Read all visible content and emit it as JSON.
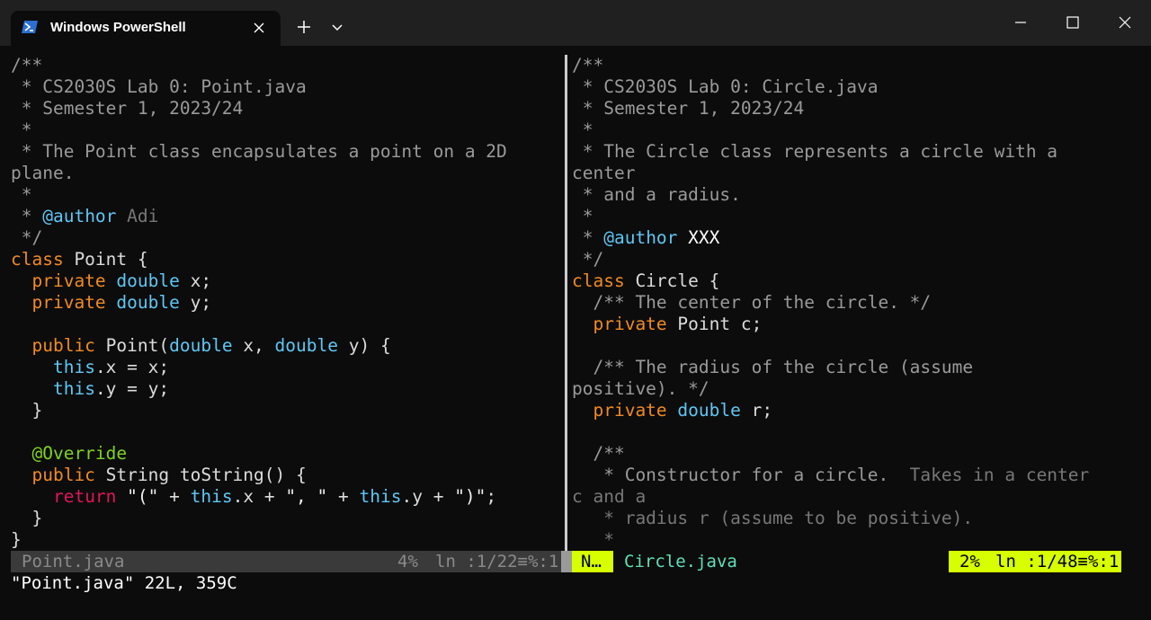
{
  "window": {
    "tab_title": "Windows PowerShell",
    "new_tab_symbol": "+",
    "dropdown_icon": "chevron-down-icon",
    "tab_icon": "powershell-icon",
    "colors": {
      "titlebar": "#202020",
      "background": "#0c0c0c",
      "status_accent": "#d7ff00"
    }
  },
  "left_pane": {
    "lines": [
      "/**",
      " * CS2030S Lab 0: Point.java",
      " * Semester 1, 2023/24",
      " *",
      " * The Point class encapsulates a point on a 2D",
      "plane.",
      " *",
      " * @author Adi",
      " */",
      "class Point {",
      "  private double x;",
      "  private double y;",
      "",
      "  public Point(double x, double y) {",
      "    this.x = x;",
      "    this.y = y;",
      "  }",
      "",
      "  @Override",
      "  public String toString() {",
      "    return \"(\" + this.x + \", \" + this.y + \")\";",
      "  }",
      "}"
    ],
    "status": {
      "filename": "Point.java",
      "percent": "4%",
      "position": "ln :1/22≡%:1"
    }
  },
  "right_pane": {
    "lines": [
      "/**",
      " * CS2030S Lab 0: Circle.java",
      " * Semester 1, 2023/24",
      " *",
      " * The Circle class represents a circle with a",
      "center",
      " * and a radius.",
      " *",
      " * @author XXX",
      " */",
      "class Circle {",
      "  /** The center of the circle. */",
      "  private Point c;",
      "",
      "  /** The radius of the circle (assume",
      "positive). */",
      "  private double r;",
      "",
      "  /**",
      "   * Constructor for a circle.  Takes in a center",
      "c and a",
      "   * radius r (assume to be positive).",
      "   *"
    ],
    "status": {
      "mode": "N…",
      "filename": "Circle.java",
      "percent": "2%",
      "position": "ln :1/48≡%:1"
    }
  },
  "command_line": "\"Point.java\" 22L, 359C"
}
